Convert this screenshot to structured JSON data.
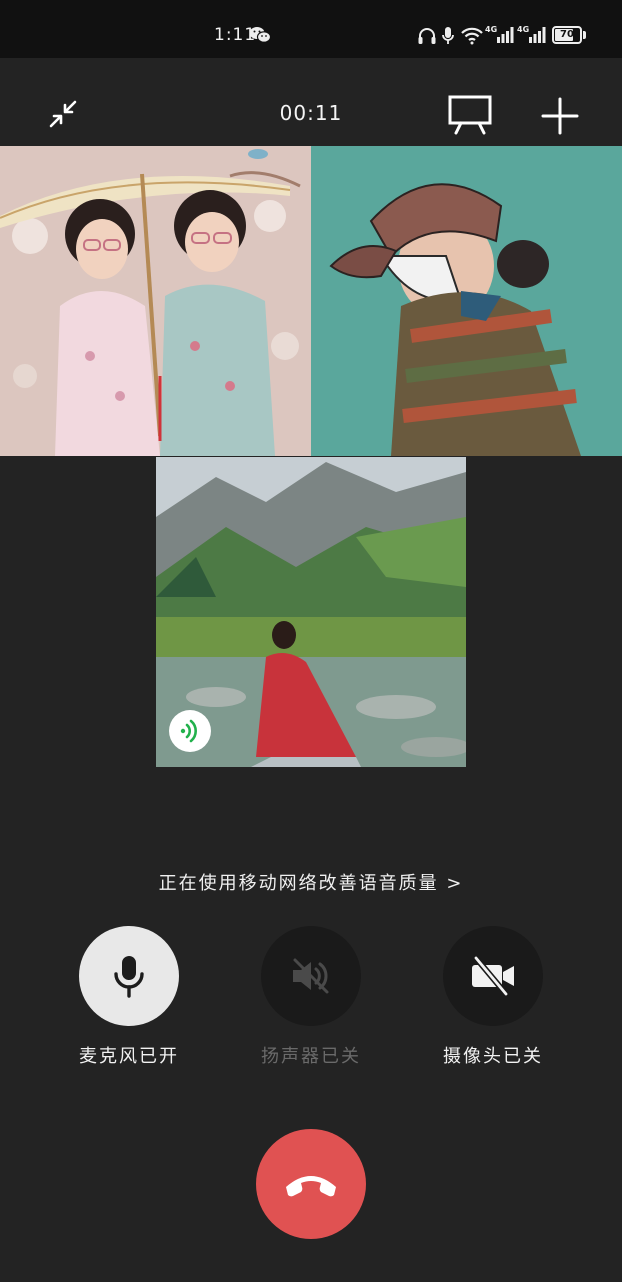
{
  "status_bar": {
    "time": "1:11",
    "wechat_icon": "wechat-icon",
    "headphones_icon": "headphones-icon",
    "mic_icon": "microphone-icon",
    "wifi_icon": "wifi-icon",
    "signal_label_1": "4G",
    "signal_label_2": "4G",
    "battery": "70"
  },
  "top_bar": {
    "minimize_icon": "minimize-icon",
    "call_timer": "00:11",
    "screen_share_icon": "screen-share-icon",
    "add_icon": "plus-icon"
  },
  "participants": [
    {
      "kind": "photo",
      "description_icon": "participant-video"
    },
    {
      "kind": "illustration",
      "description_icon": "participant-video"
    },
    {
      "kind": "photo",
      "speaking": true,
      "speaking_icon": "speaking-icon"
    }
  ],
  "network_tip": "正在使用移动网络改善语音质量 >",
  "controls": {
    "microphone": {
      "label": "麦克风已开",
      "state": "on"
    },
    "speaker": {
      "label": "扬声器已关",
      "state": "off"
    },
    "camera": {
      "label": "摄像头已关",
      "state": "off"
    }
  },
  "hangup_icon": "hang-up-icon",
  "colors": {
    "background": "#232323",
    "status_bar": "#111111",
    "hangup": "#e05252",
    "speaking_indicator": "#22b14c",
    "control_on": "#e8e8e8",
    "control_off": "#1a1a1a"
  }
}
